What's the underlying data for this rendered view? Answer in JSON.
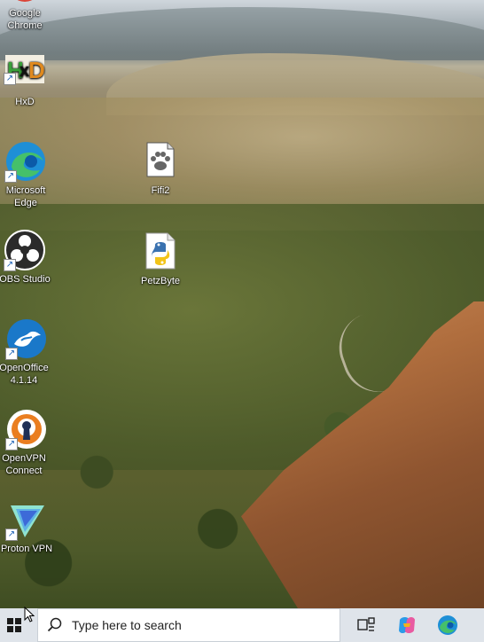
{
  "desktop": {
    "icons": [
      {
        "label": "Google Chrome",
        "icon": "chrome-icon"
      },
      {
        "label": "HxD",
        "icon": "hxd-icon"
      },
      {
        "label": "Microsoft Edge",
        "icon": "edge-icon"
      },
      {
        "label": "OBS Studio",
        "icon": "obs-icon"
      },
      {
        "label": "OpenOffice 4.1.14",
        "icon": "openoffice-icon"
      },
      {
        "label": "OpenVPN Connect",
        "icon": "openvpn-icon"
      },
      {
        "label": "Proton VPN",
        "icon": "protonvpn-icon"
      },
      {
        "label": "Fifi2",
        "icon": "paw-file-icon"
      },
      {
        "label": "PetzByte",
        "icon": "python-file-icon"
      }
    ]
  },
  "taskbar": {
    "search_placeholder": "Type here to search",
    "buttons": [
      {
        "name": "start",
        "icon": "windows-logo-icon"
      },
      {
        "name": "task-view",
        "icon": "task-view-icon"
      },
      {
        "name": "copilot",
        "icon": "copilot-icon"
      },
      {
        "name": "edge",
        "icon": "edge-icon"
      }
    ]
  },
  "colors": {
    "taskbar_bg": "#dfe4ea",
    "search_bg": "#ffffff",
    "label_text": "#ffffff"
  }
}
